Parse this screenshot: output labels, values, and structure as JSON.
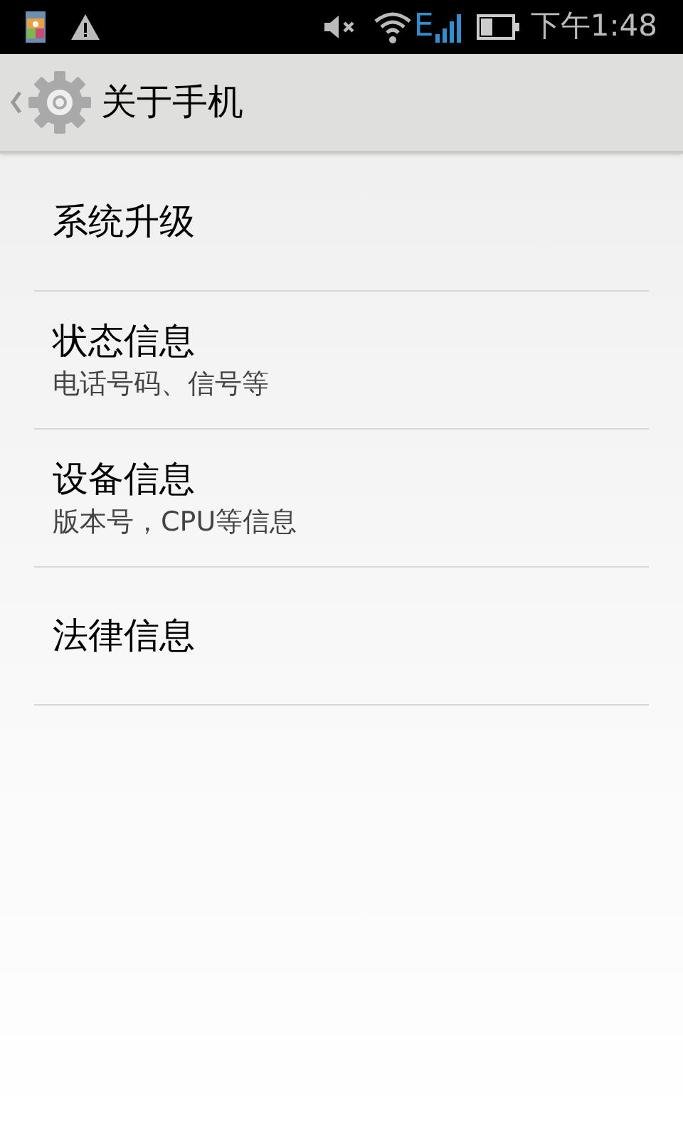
{
  "status_bar": {
    "network_type": "E",
    "time": "下午1:48"
  },
  "header": {
    "title": "关于手机"
  },
  "items": [
    {
      "title": "系统升级"
    },
    {
      "title": "状态信息",
      "subtitle": "电话号码、信号等"
    },
    {
      "title": "设备信息",
      "subtitle": "版本号，CPU等信息"
    },
    {
      "title": "法律信息"
    }
  ]
}
